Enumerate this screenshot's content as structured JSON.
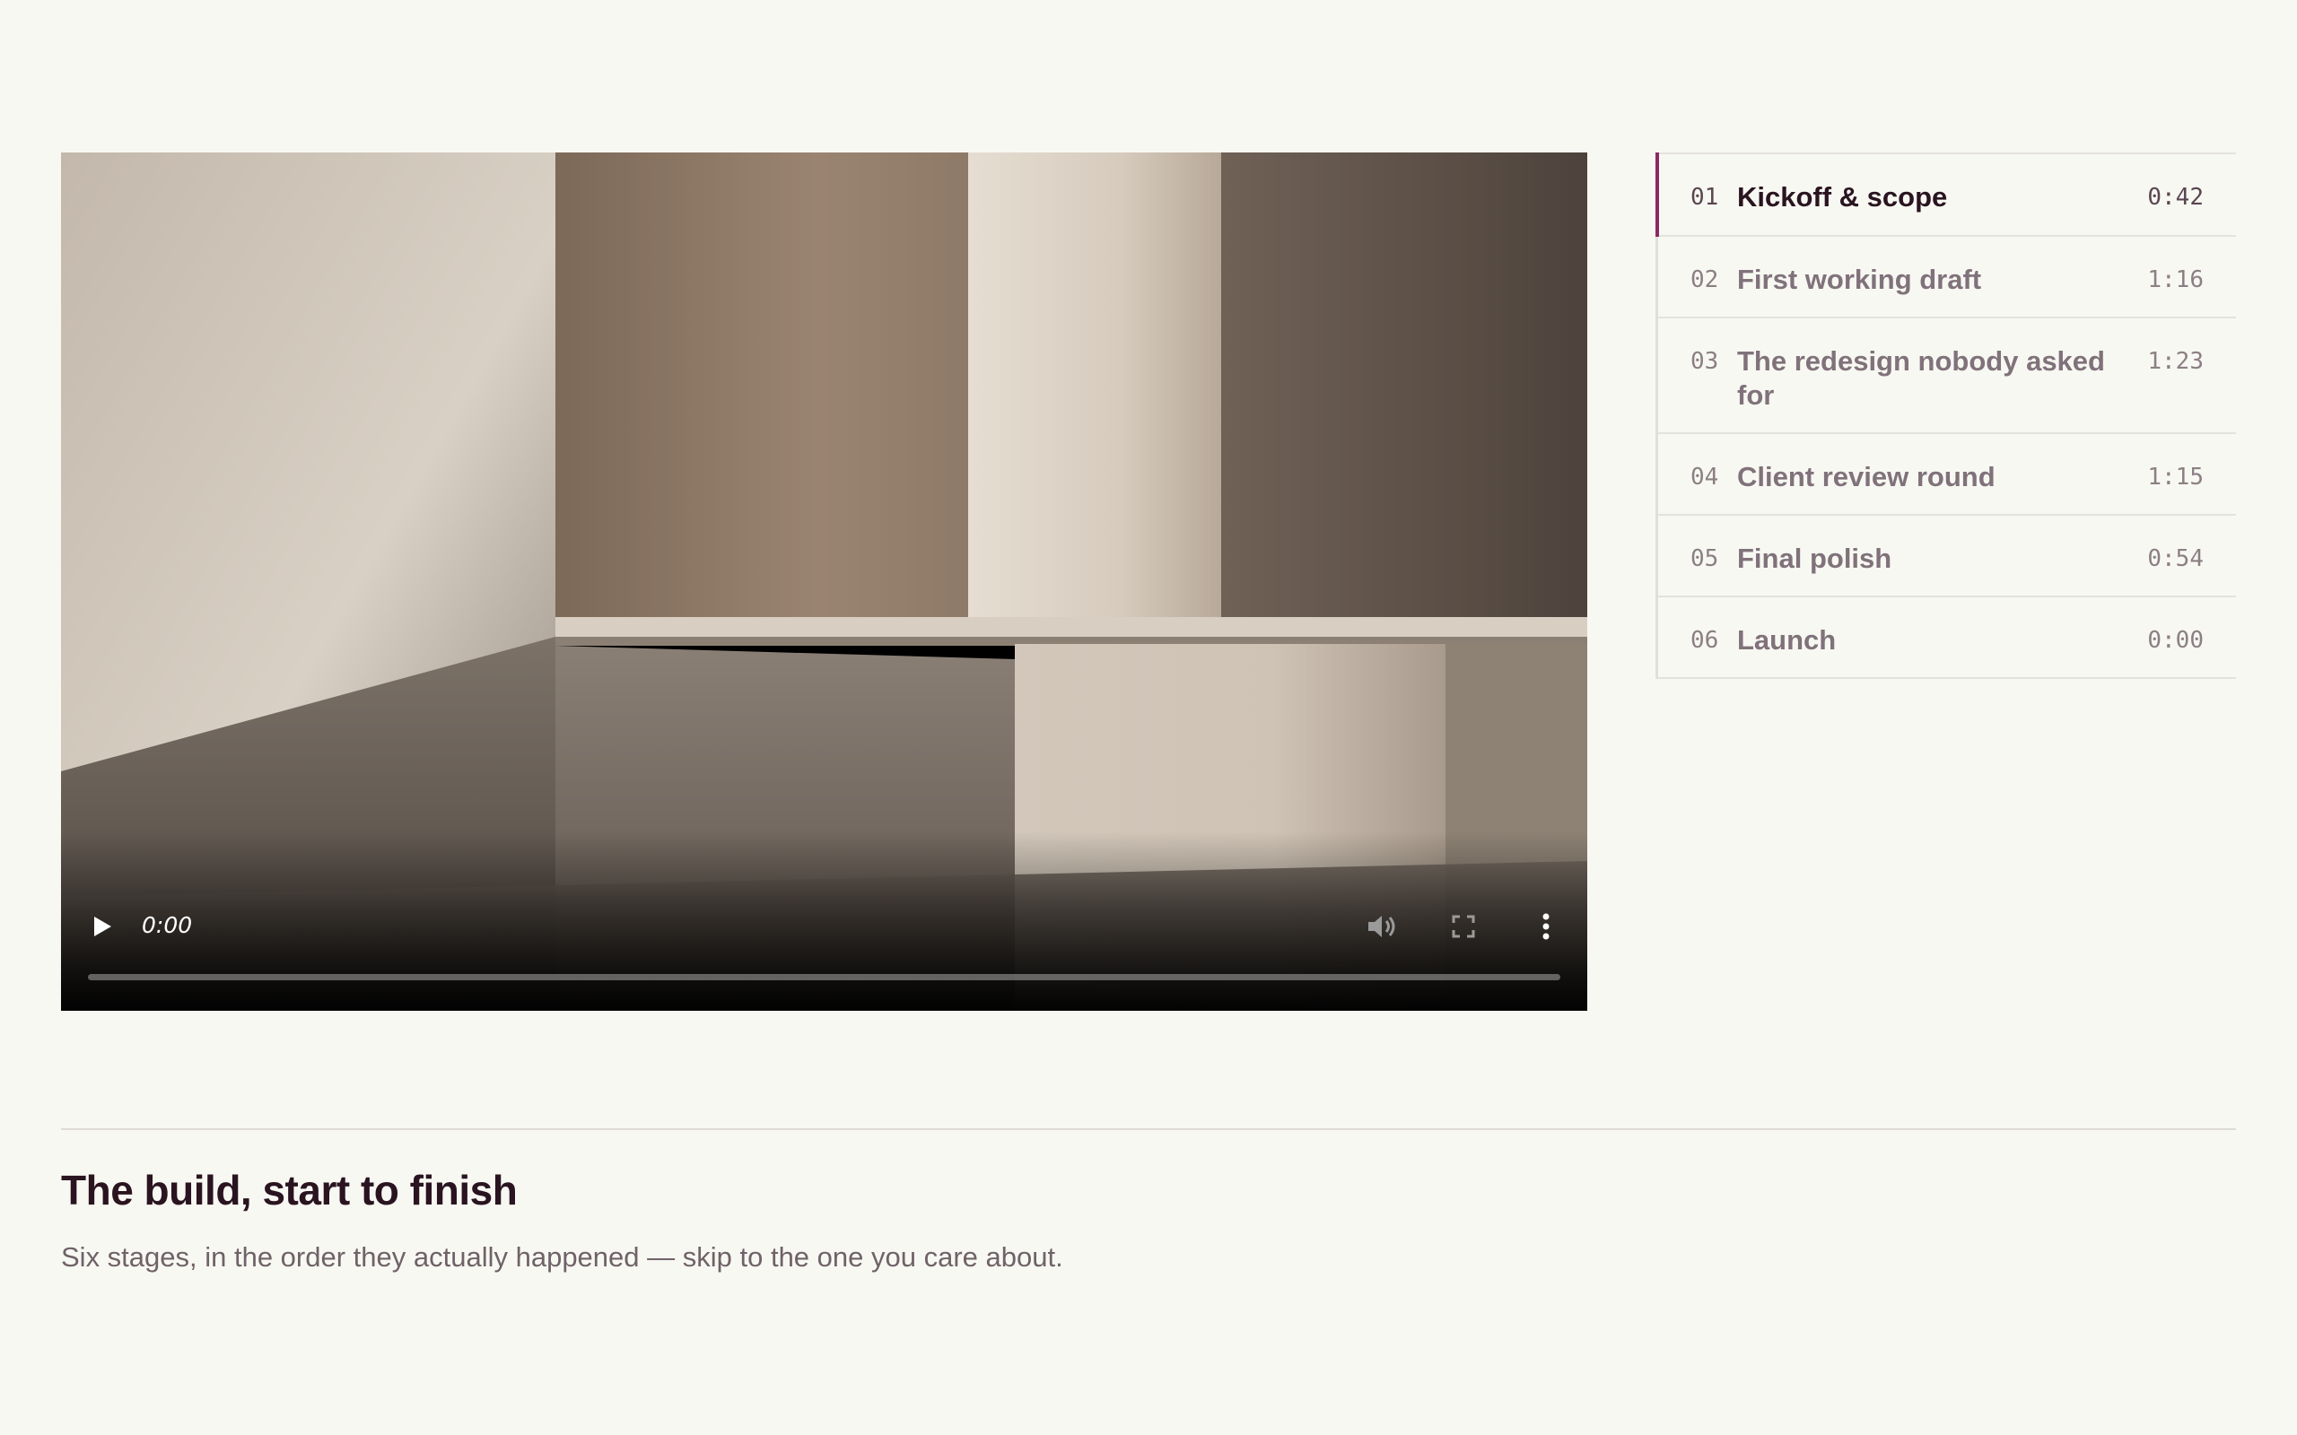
{
  "player": {
    "time_display": "0:00",
    "progress": 0,
    "icons": {
      "play": "play-icon",
      "mute": "volume-icon",
      "fullscreen": "fullscreen-icon",
      "more": "more-vertical-icon"
    }
  },
  "chapters": [
    {
      "num": "01",
      "title": "Kickoff & scope",
      "duration": "0:42",
      "active": true
    },
    {
      "num": "02",
      "title": "First working draft",
      "duration": "1:16",
      "active": false
    },
    {
      "num": "03",
      "title": "The redesign nobody asked for",
      "duration": "1:23",
      "active": false
    },
    {
      "num": "04",
      "title": "Client review round",
      "duration": "1:15",
      "active": false
    },
    {
      "num": "05",
      "title": "Final polish",
      "duration": "0:54",
      "active": false
    },
    {
      "num": "06",
      "title": "Launch",
      "duration": "0:00",
      "active": false
    }
  ],
  "section": {
    "title": "The build, start to finish",
    "subtitle": "Six stages, in the order they actually happened — skip to the one you care about."
  },
  "colors": {
    "background": "#f8f8f3",
    "accent": "#8a2a64",
    "heading": "#2a1420",
    "muted": "#80727a"
  }
}
